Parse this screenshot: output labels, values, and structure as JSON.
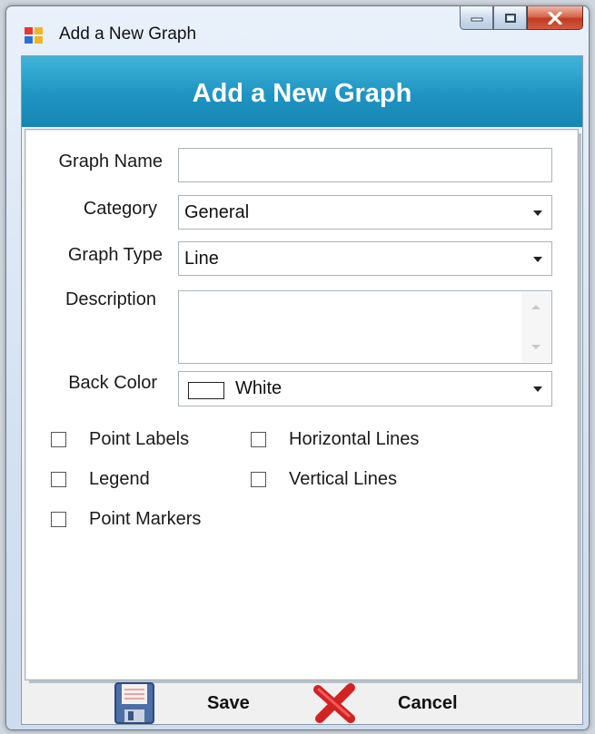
{
  "window": {
    "title": "Add a New Graph",
    "controls": [
      "minimize",
      "maximize",
      "close"
    ]
  },
  "header": {
    "title": "Add a New Graph",
    "color": "#2299c6"
  },
  "form": {
    "graph_name": {
      "label": "Graph Name",
      "value": "",
      "placeholder": ""
    },
    "category": {
      "label": "Category",
      "value": "General"
    },
    "graph_type": {
      "label": "Graph Type",
      "value": "Line"
    },
    "description": {
      "label": "Description",
      "value": ""
    },
    "back_color": {
      "label": "Back Color",
      "value": "White",
      "swatch": "#ffffff"
    }
  },
  "options": {
    "point_labels": {
      "label": "Point Labels",
      "checked": false
    },
    "horizontal_lines": {
      "label": "Horizontal Lines",
      "checked": false
    },
    "legend": {
      "label": "Legend",
      "checked": false
    },
    "vertical_lines": {
      "label": "Vertical Lines",
      "checked": false
    },
    "point_markers": {
      "label": "Point Markers",
      "checked": false
    }
  },
  "footer": {
    "save_label": "Save",
    "cancel_label": "Cancel",
    "save_icon": "floppy-disk-icon",
    "cancel_icon": "red-x-icon"
  }
}
